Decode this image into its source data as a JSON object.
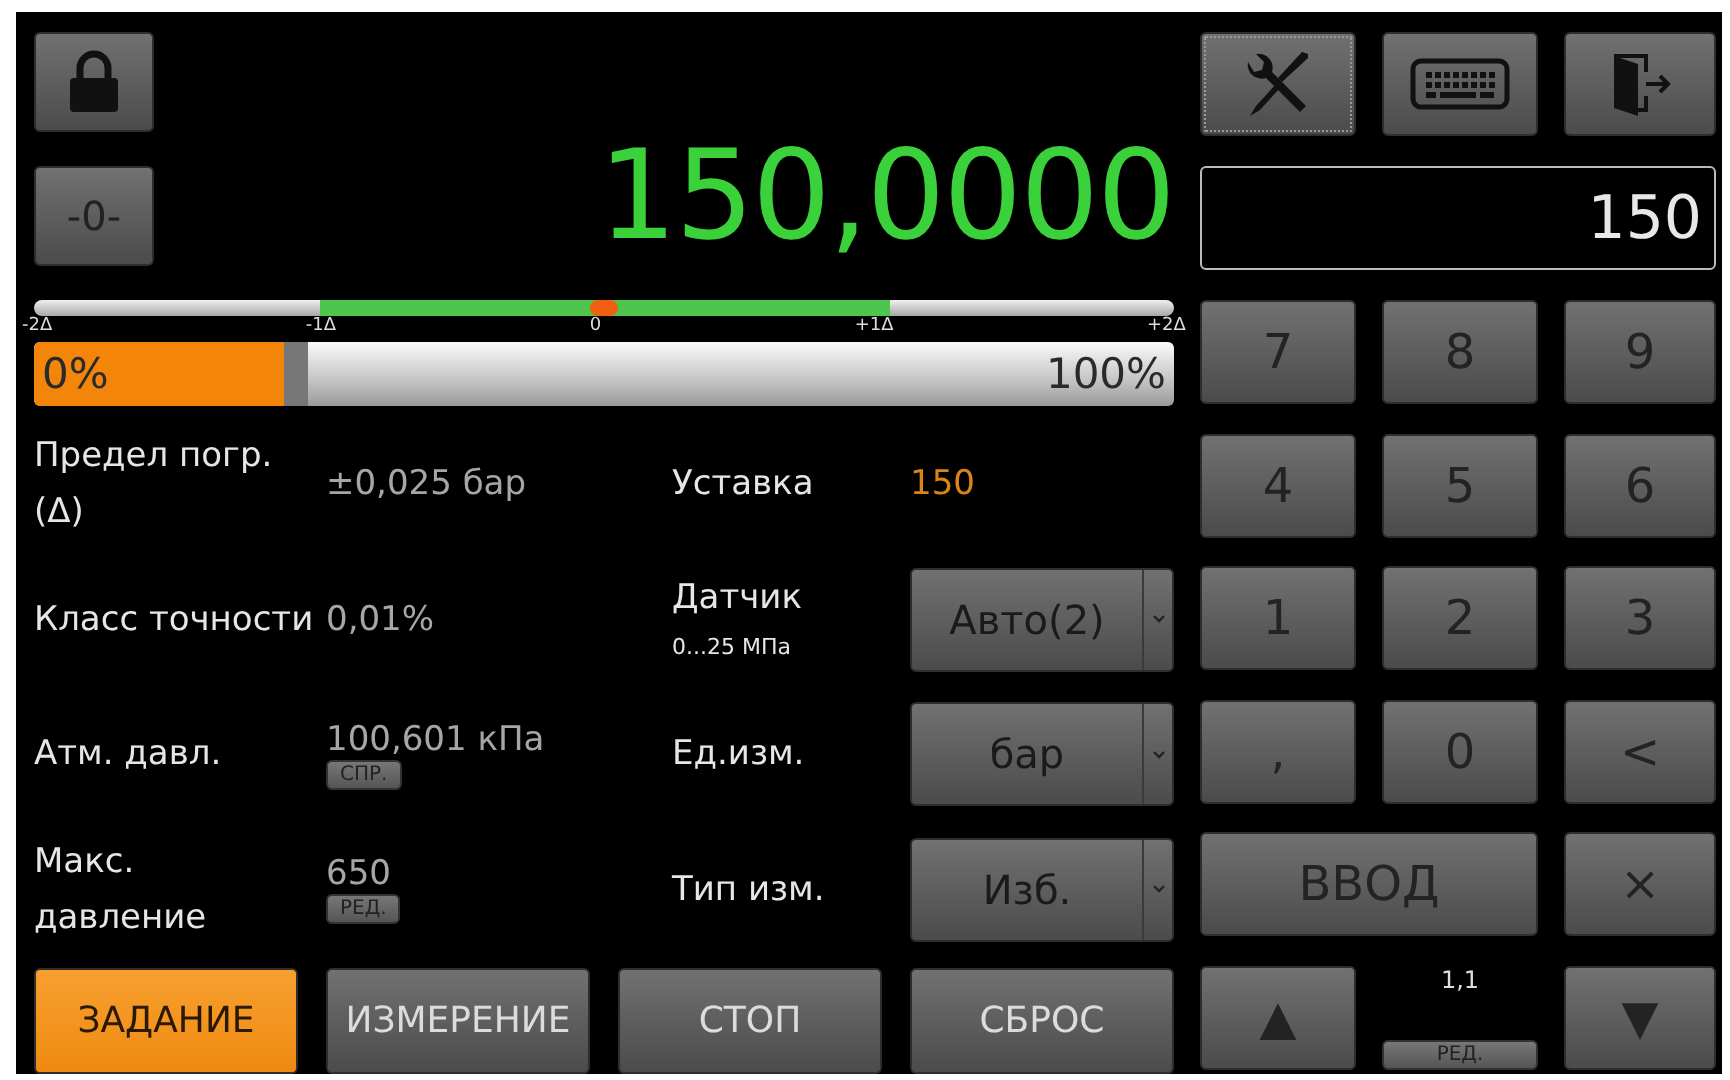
{
  "zero_button": "-0-",
  "reading": "150,0000",
  "deviation_scale": {
    "labels": [
      "-2Δ",
      "-1Δ",
      "0",
      "+1Δ",
      "+2Δ"
    ],
    "level": 0.5
  },
  "progress": {
    "level": 0.22,
    "min_label": "0%",
    "max_label": "100%"
  },
  "rows": [
    {
      "left": {
        "label": "Предел погр. (Δ)",
        "value": "±0,025 бар"
      },
      "right": {
        "kind": "value",
        "label": "Уставка",
        "value": "150"
      }
    },
    {
      "left": {
        "label": "Класс точности",
        "value": "0,01%"
      },
      "right": {
        "kind": "dropdown",
        "label": "Датчик",
        "sublabel": "0...25 МПа",
        "value": "Авто(2)"
      }
    },
    {
      "left": {
        "label": "Атм. давл.",
        "value": "100,601 кПа",
        "badge": "СПР."
      },
      "right": {
        "kind": "dropdown",
        "label": "Ед.изм.",
        "value": "бар"
      }
    },
    {
      "left": {
        "label": "Макс. давление",
        "value": "650",
        "badge": "РЕД."
      },
      "right": {
        "kind": "dropdown",
        "label": "Тип изм.",
        "value": "Изб."
      }
    }
  ],
  "modes": [
    {
      "label": "ЗАДАНИЕ",
      "selected": true
    },
    {
      "label": "ИЗМЕРЕНИЕ",
      "selected": false
    },
    {
      "label": "СТОП",
      "selected": false
    },
    {
      "label": "СБРОС",
      "selected": false
    }
  ],
  "input": {
    "value": "150"
  },
  "keys": [
    {
      "kind": "key",
      "label": "7"
    },
    {
      "kind": "key",
      "label": "8"
    },
    {
      "kind": "key",
      "label": "9"
    },
    {
      "kind": "key",
      "label": "4"
    },
    {
      "kind": "key",
      "label": "5"
    },
    {
      "kind": "key",
      "label": "6"
    },
    {
      "kind": "key",
      "label": "1"
    },
    {
      "kind": "key",
      "label": "2"
    },
    {
      "kind": "key",
      "label": "3"
    },
    {
      "kind": "key",
      "label": ","
    },
    {
      "kind": "key",
      "label": "0"
    },
    {
      "kind": "key",
      "label": "<"
    },
    {
      "kind": "wide",
      "label": "ВВОД"
    },
    {
      "kind": "key",
      "label": "×"
    }
  ],
  "step": {
    "up": "▲",
    "value": "1,1",
    "badge": "РЕД.",
    "down": "▼"
  }
}
